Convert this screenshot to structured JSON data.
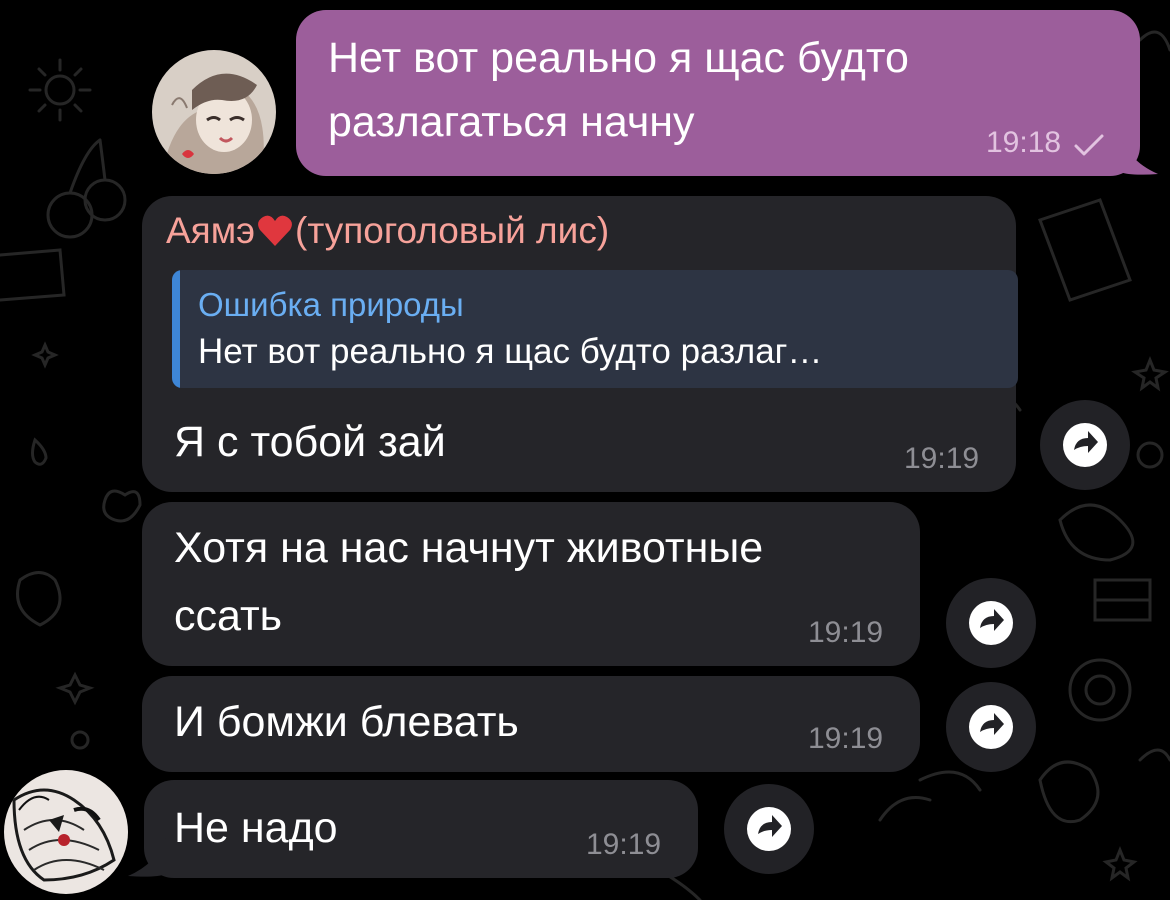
{
  "messages": [
    {
      "id": "out-1",
      "direction": "outgoing",
      "text_lines": [
        "Нет вот реально я щас будто",
        "разлагаться начну"
      ],
      "time": "19:18",
      "status": "sent"
    },
    {
      "id": "in-1",
      "direction": "incoming",
      "sender": {
        "prefix": "Аямэ",
        "suffix": "(тупоголовый лис)",
        "emoji": "heart-icon"
      },
      "reply": {
        "author": "Ошибка природы",
        "text": "Нет вот реально я щас будто разлаг…"
      },
      "text_lines": [
        "Я с тобой зай"
      ],
      "time": "19:19"
    },
    {
      "id": "in-2",
      "direction": "incoming",
      "text_lines": [
        "Хотя на нас начнут животные",
        "ссать"
      ],
      "time": "19:19"
    },
    {
      "id": "in-3",
      "direction": "incoming",
      "text_lines": [
        "И бомжи блевать"
      ],
      "time": "19:19"
    },
    {
      "id": "in-4",
      "direction": "incoming",
      "text_lines": [
        "Не надо"
      ],
      "time": "19:19"
    }
  ],
  "icons": {
    "share": "share-arrow-icon",
    "read_status": "checkmark-icon",
    "sender_emoji": "heart-icon"
  },
  "colors": {
    "background": "#000000",
    "outgoing_bubble": "#9c5e9b",
    "incoming_bubble": "#252529",
    "sender_name": "#f7a29a",
    "reply_accent": "#3e86d6",
    "reply_author": "#6aaef2"
  }
}
